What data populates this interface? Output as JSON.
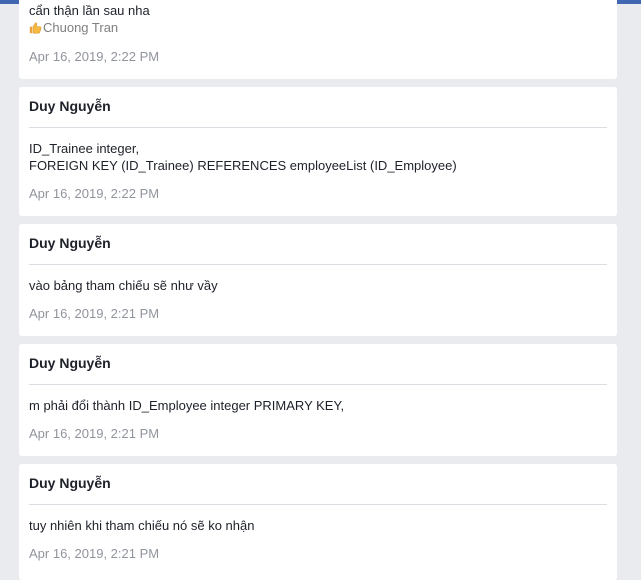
{
  "posts": [
    {
      "body_lines": [
        "cẩn thận lần sau nha"
      ],
      "signature": "Chuong Tran",
      "signature_icon": "thumbs-up-icon",
      "timestamp": "Apr 16, 2019, 2:22 PM"
    },
    {
      "author": "Duy Nguyễn",
      "body_lines": [
        "ID_Trainee integer,",
        "FOREIGN KEY (ID_Trainee) REFERENCES employeeList (ID_Employee)"
      ],
      "timestamp": "Apr 16, 2019, 2:22 PM"
    },
    {
      "author": "Duy Nguyễn",
      "body_lines": [
        "vào bảng tham chiếu sẽ như vầy"
      ],
      "timestamp": "Apr 16, 2019, 2:21 PM"
    },
    {
      "author": "Duy Nguyễn",
      "body_lines": [
        "m phải đổi thành ID_Employee integer PRIMARY KEY,"
      ],
      "timestamp": "Apr 16, 2019, 2:21 PM"
    },
    {
      "author": "Duy Nguyễn",
      "body_lines": [
        "tuy nhiên khi tham chiếu nó sẽ ko nhận"
      ],
      "timestamp": "Apr 16, 2019, 2:21 PM"
    }
  ],
  "colors": {
    "accent": "#4267b2",
    "background": "#e9ebee",
    "text": "#1d2129",
    "muted": "#90949c"
  }
}
